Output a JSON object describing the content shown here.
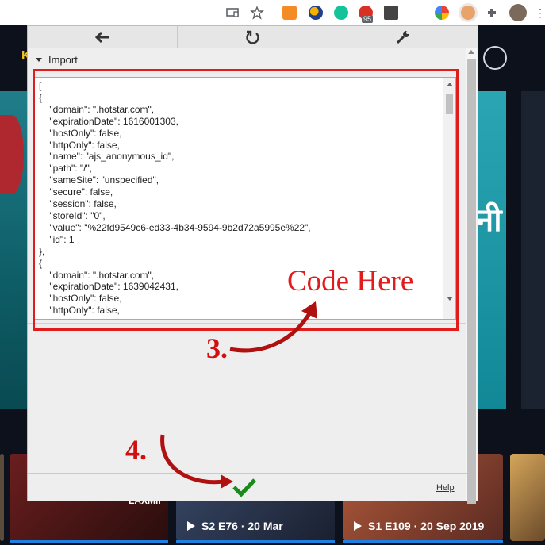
{
  "browser": {
    "extension_badge": "95"
  },
  "background_page": {
    "hero_text": "नी",
    "episodes": [
      {
        "label": "S2 E76 · 20 Mar"
      },
      {
        "label": "S1 E109 · 20 Sep 2019"
      }
    ],
    "thumb_titles": [
      "LAXMII"
    ]
  },
  "popup": {
    "toolbar": {
      "back_icon": "arrow-left-icon",
      "reset_icon": "reset-icon",
      "options_icon": "wrench-icon"
    },
    "section_label": "Import",
    "code_text": "[\n{\n    \"domain\": \".hotstar.com\",\n    \"expirationDate\": 1616001303,\n    \"hostOnly\": false,\n    \"httpOnly\": false,\n    \"name\": \"ajs_anonymous_id\",\n    \"path\": \"/\",\n    \"sameSite\": \"unspecified\",\n    \"secure\": false,\n    \"session\": false,\n    \"storeId\": \"0\",\n    \"value\": \"%22fd9549c6-ed33-4b34-9594-9b2d72a5995e%22\",\n    \"id\": 1\n},\n{\n    \"domain\": \".hotstar.com\",\n    \"expirationDate\": 1639042431,\n    \"hostOnly\": false,\n    \"httpOnly\": false,",
    "help_label": "Help",
    "confirm_icon": "checkmark-icon"
  },
  "annotations": {
    "code_here": "Code Here",
    "step3": "3.",
    "step4": "4.",
    "color": "#e01c1c"
  }
}
